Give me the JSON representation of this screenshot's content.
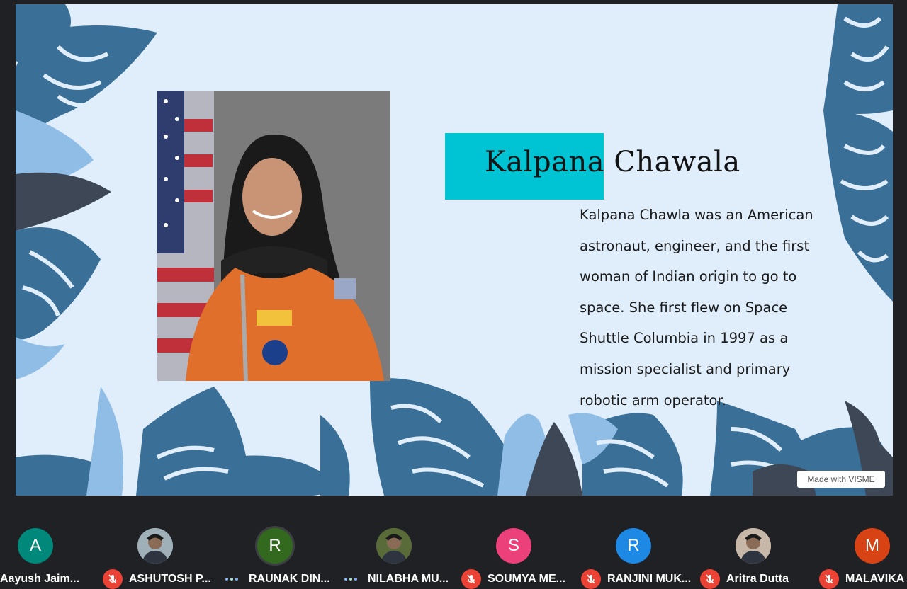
{
  "slide": {
    "title": "Kalpana Chawala",
    "body": "Kalpana Chawla was an American astronaut, engineer, and the first woman of Indian origin to go to space. She first flew on Space Shuttle Columbia in 1997 as a mission specialist and primary robotic arm operator.",
    "badge": "Made with VISME",
    "photo_icon": "astronaut-portrait",
    "colors": {
      "background": "#e0eefc",
      "title_box": "#00c4d3",
      "leaf_dark": "#3a6f97",
      "leaf_light": "#8fbde6"
    }
  },
  "participants": [
    {
      "initial": "A",
      "name": "Aayush Jaim...",
      "avatar_color": "#00897b",
      "mic_muted": false,
      "speaking": false,
      "has_photo": false
    },
    {
      "initial": "",
      "name": "ASHUTOSH P...",
      "avatar_color": "#9fb0b8",
      "mic_muted": true,
      "speaking": false,
      "has_photo": true
    },
    {
      "initial": "R",
      "name": "RAUNAK DIN...",
      "avatar_color": "#33691e",
      "mic_muted": false,
      "speaking": true,
      "has_photo": false
    },
    {
      "initial": "",
      "name": "NILABHA MU...",
      "avatar_color": "#5a6b3a",
      "mic_muted": false,
      "speaking": true,
      "has_photo": true
    },
    {
      "initial": "S",
      "name": "SOUMYA ME...",
      "avatar_color": "#ec407a",
      "mic_muted": true,
      "speaking": false,
      "has_photo": false
    },
    {
      "initial": "R",
      "name": "RANJINI MUK...",
      "avatar_color": "#1e88e5",
      "mic_muted": true,
      "speaking": false,
      "has_photo": false
    },
    {
      "initial": "",
      "name": "Aritra Dutta",
      "avatar_color": "#c7b7a8",
      "mic_muted": true,
      "speaking": false,
      "has_photo": true
    },
    {
      "initial": "M",
      "name": "MALAVIKA A...",
      "avatar_color": "#d84315",
      "mic_muted": true,
      "speaking": false,
      "has_photo": false
    }
  ],
  "icons": {
    "mic_muted": "mic-off-icon",
    "speaking": "audio-dots-icon"
  }
}
